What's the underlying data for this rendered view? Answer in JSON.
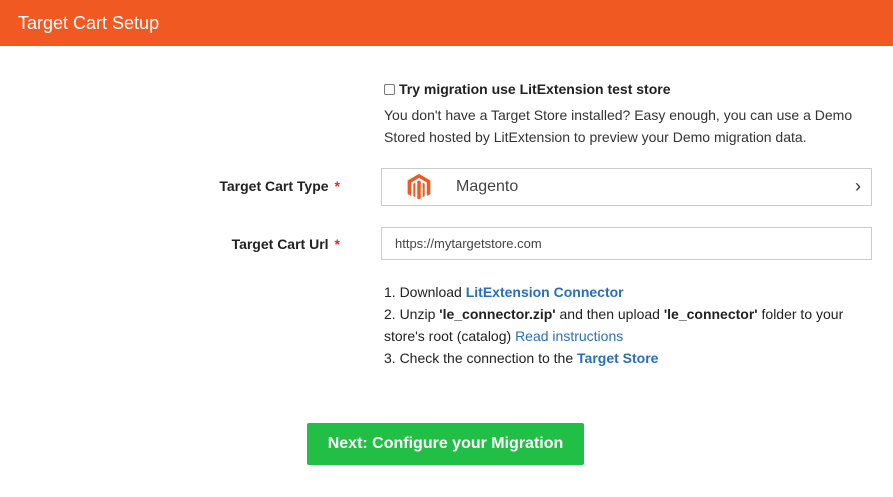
{
  "header": {
    "title": "Target Cart Setup"
  },
  "test_store": {
    "checkbox_label": "Try migration use LitExtension test store",
    "checked": false,
    "description": "You don't have a Target Store installed? Easy enough, you can use a Demo Stored hosted by LitExtension to preview your Demo migration data."
  },
  "cart_type": {
    "label": "Target Cart Type",
    "required": "*",
    "value": "Magento",
    "icon": "magento-logo",
    "chevron": "›"
  },
  "cart_url": {
    "label": "Target Cart Url",
    "required": "*",
    "value": "https://mytargetstore.com"
  },
  "steps": {
    "s1_prefix": "1. Download ",
    "s1_link": "LitExtension Connector",
    "s2_prefix": "2. Unzip ",
    "s2_zip": "'le_connector.zip'",
    "s2_mid": " and then upload ",
    "s2_folder": "'le_connector'",
    "s2_suffix": " folder to your store's root (catalog) ",
    "s2_link": "Read instructions",
    "s3_prefix": "3. Check the connection to the ",
    "s3_link": "Target Store"
  },
  "next_button": "Next: Configure your Migration",
  "colors": {
    "header": "#f05a22",
    "button": "#21bf45",
    "link": "#2a6ebb"
  }
}
